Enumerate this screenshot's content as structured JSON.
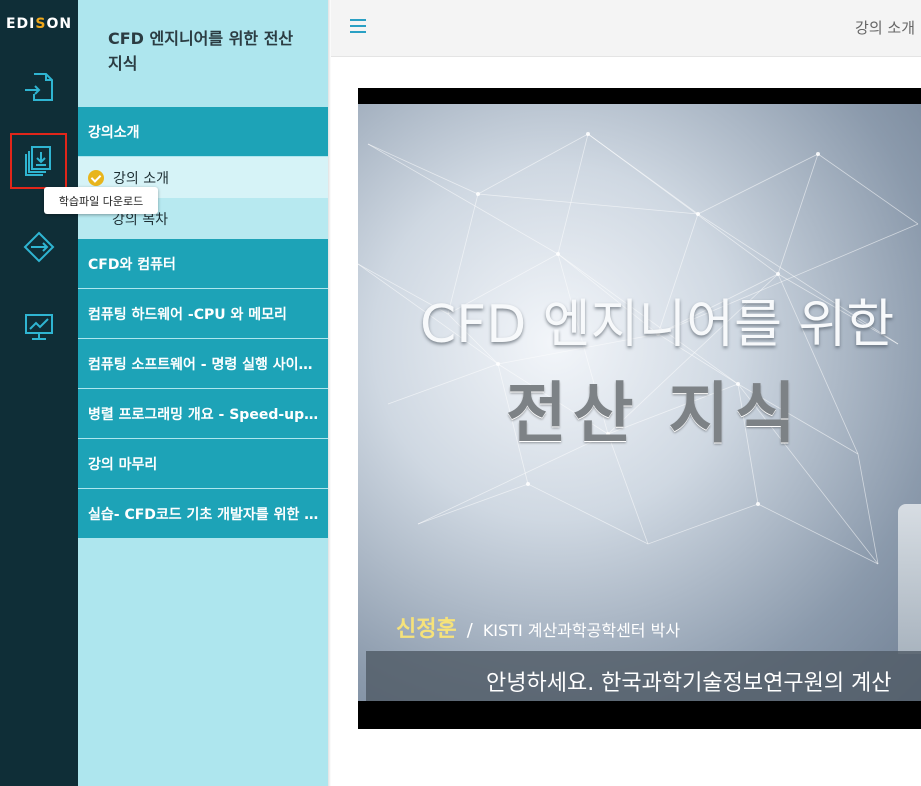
{
  "rail": {
    "logo": {
      "pre": "EDI",
      "o": "S",
      "post": "ON"
    },
    "tooltip": "학습파일 다운로드",
    "buttons": [
      {
        "icon": "lecture-login-icon"
      },
      {
        "icon": "file-download-icon"
      },
      {
        "icon": "navigate-icon"
      },
      {
        "icon": "chart-screen-icon"
      }
    ]
  },
  "menu": {
    "title": "CFD 엔지니어를 위한 전산 지식",
    "sections": [
      {
        "label": "강의소개"
      },
      {
        "label": "CFD와 컴퓨터"
      },
      {
        "label": "컴퓨팅 하드웨어 -CPU 와 메모리"
      },
      {
        "label": "컴퓨팅 소프트웨어 - 명령 실행 사이…"
      },
      {
        "label": "병렬 프로그래밍 개요 - Speed-up …"
      },
      {
        "label": "강의 마무리"
      },
      {
        "label": "실습- CFD코드 기초 개발자를 위한 …"
      }
    ],
    "sub_items": [
      {
        "label": "강의 소개",
        "completed": true
      },
      {
        "label": "강의 목차",
        "completed": false
      }
    ]
  },
  "topbar": {
    "title": "강의 소개"
  },
  "video": {
    "title_line1": "CFD 엔지니어를 위한",
    "title_line2": "전산 지식",
    "speaker_name": "신정훈",
    "speaker_sep": "/",
    "speaker_affiliation": "KISTI 계산과학공학센터 박사",
    "subtitle": "안녕하세요. 한국과학기술정보연구원의 계산"
  },
  "colors": {
    "rail_bg": "#0f2e37",
    "menu_bg": "#aee6ee",
    "section_bg": "#1da3b7",
    "accent": "#2aa0c4",
    "check": "#e8b51c",
    "highlight_box": "#e0261a"
  }
}
